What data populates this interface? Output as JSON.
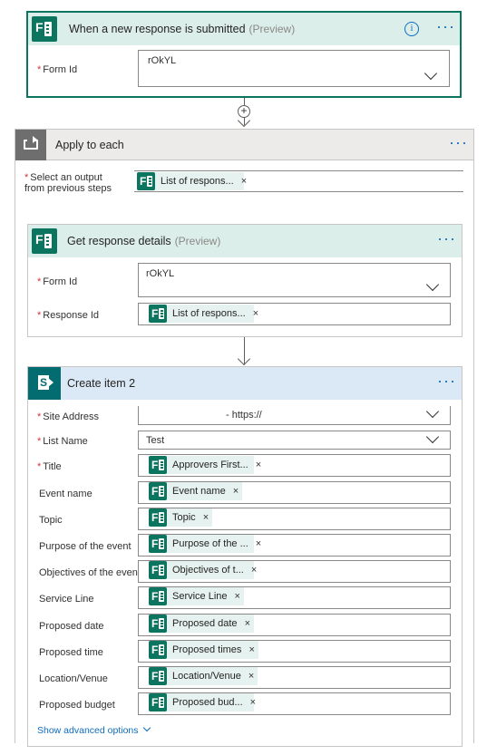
{
  "trigger": {
    "title": "When a new response is submitted",
    "preview": "(Preview)",
    "form_id_label": "Form Id",
    "form_id_value": "rOkYL",
    "info_icon": "info-icon",
    "menu_icon": "more-icon"
  },
  "add_step_icon": "plus-icon",
  "apply_each": {
    "title": "Apply to each",
    "select_label_line1": "Select an output",
    "select_label_line2": "from previous steps",
    "token": "List of respons..."
  },
  "get_details": {
    "title": "Get response details",
    "preview": "(Preview)",
    "form_id_label": "Form Id",
    "form_id_value": "rOkYL",
    "response_id_label": "Response Id",
    "response_token": "List of respons..."
  },
  "create_item": {
    "title": "Create item 2",
    "site_label": "Site Address",
    "site_value": "- https://",
    "list_label": "List Name",
    "list_value": "Test",
    "fields": [
      {
        "label": "Title",
        "required": "*",
        "token": "Approvers First..."
      },
      {
        "label": "Event name",
        "required": "",
        "token": "Event name"
      },
      {
        "label": "Topic",
        "required": "",
        "token": "Topic"
      },
      {
        "label": "Purpose of the event",
        "required": "",
        "token": "Purpose of the ..."
      },
      {
        "label": "Objectives of the event",
        "required": "",
        "token": "Objectives of t..."
      },
      {
        "label": "Service Line",
        "required": "",
        "token": "Service Line"
      },
      {
        "label": "Proposed date",
        "required": "",
        "token": "Proposed date"
      },
      {
        "label": "Proposed time",
        "required": "",
        "token": "Proposed times"
      },
      {
        "label": "Location/Venue",
        "required": "",
        "token": "Location/Venue"
      },
      {
        "label": "Proposed budget",
        "required": "",
        "token": "Proposed bud..."
      }
    ],
    "advanced": "Show advanced options"
  },
  "required_mark": "*",
  "remove_mark": "×",
  "colors": {
    "forms_green": "#0b7560",
    "token_bg": "#e6f2ef",
    "header_green": "#dbeee9",
    "header_gray": "#edebe9",
    "header_blue": "#dbe8f5",
    "link_blue": "#0f6cbd",
    "required_red": "#d13438"
  }
}
